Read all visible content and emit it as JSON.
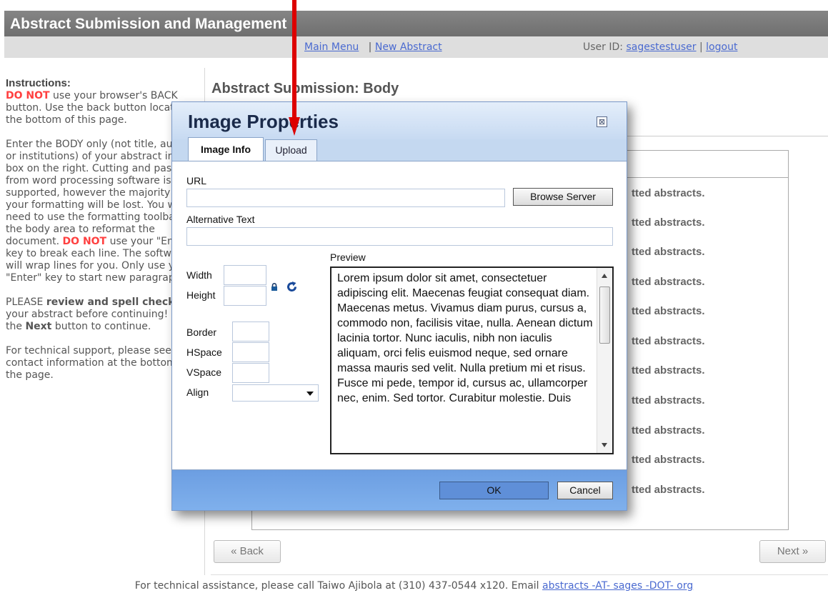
{
  "app": {
    "title": "Abstract Submission and Management"
  },
  "nav": {
    "main_menu": "Main Menu",
    "separator": "|",
    "new_abstract": "New Abstract",
    "user_label": "User ID:",
    "user_id": "sagestestuser",
    "logout": "logout"
  },
  "sidebar": {
    "heading": "Instructions:",
    "p1_warn": "DO NOT",
    "p1_rest": " use your browser's BACK button. Use the back button located at the bottom of this page.",
    "p2_a": "Enter the BODY only (not title, authors or institutions) of your abstract in the box on the right. Cutting and pasting from word processing software is supported, however the majority of your formatting will be lost. You will need to use the formatting toolbar in the body area to reformat the document. ",
    "p2_warn": "DO NOT",
    "p2_b": " use your \"Enter\" key to break each line. The software will wrap lines for you. Only use your \"Enter\" key to start new paragraphs.",
    "p3_a": "PLEASE ",
    "p3_bold": "review and spell check",
    "p3_b": " your abstract before continuing! Click the ",
    "p3_next": "Next",
    "p3_c": " button to continue.",
    "p4": "For technical support, please see the contact information at the bottom of the page."
  },
  "main": {
    "title": "Abstract Submission: Body",
    "row_text": "tted abstracts.",
    "back_button": "« Back",
    "next_button": "Next »"
  },
  "dialog": {
    "title": "Image Properties",
    "close_symbol": "⊠",
    "tabs": [
      {
        "label": "Image Info",
        "active": true
      },
      {
        "label": "Upload",
        "active": false
      }
    ],
    "url_label": "URL",
    "url_value": "",
    "browse_button": "Browse Server",
    "alt_label": "Alternative Text",
    "alt_value": "",
    "width_label": "Width",
    "height_label": "Height",
    "border_label": "Border",
    "hspace_label": "HSpace",
    "vspace_label": "VSpace",
    "align_label": "Align",
    "align_value": "",
    "preview_label": "Preview",
    "preview_text": "Lorem ipsum dolor sit amet, consectetuer adipiscing elit. Maecenas feugiat consequat diam. Maecenas metus. Vivamus diam purus, cursus a, commodo non, facilisis vitae, nulla. Aenean dictum lacinia tortor. Nunc iaculis, nibh non iaculis aliquam, orci felis euismod neque, sed ornare massa mauris sed velit. Nulla pretium mi et risus. Fusce mi pede, tempor id, cursus ac, ullamcorper nec, enim. Sed tortor. Curabitur molestie. Duis",
    "ok_button": "OK",
    "cancel_button": "Cancel"
  },
  "footer": {
    "text": "For technical assistance, please call Taiwo Ajibola at (310) 437-0544 x120. Email ",
    "email_link": "abstracts -AT- sages -DOT- org"
  },
  "colors": {
    "title_bar": "#7a7a7a",
    "nav_bar": "#dedede",
    "link": "#4a6ad0",
    "warning": "#ff4040",
    "dialog_frame": "#c4d8f0",
    "dialog_footer": "#7aa8e8",
    "annotation_arrow": "#dd0000"
  }
}
